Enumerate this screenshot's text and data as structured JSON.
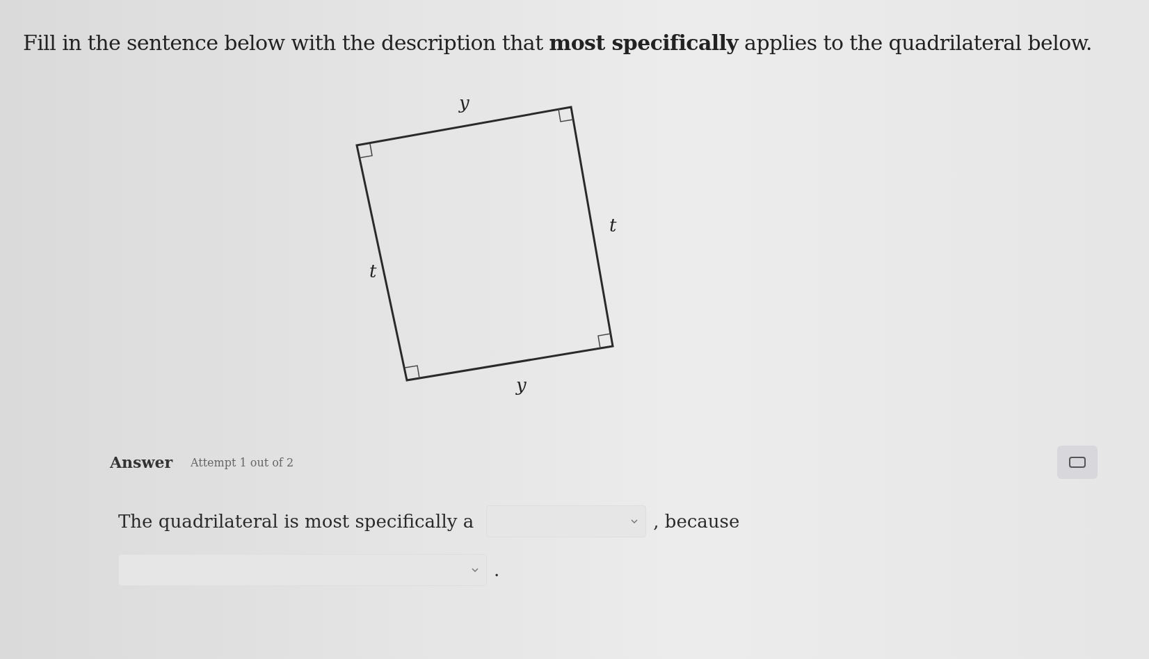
{
  "question": "Fill in the sentence below with the description that **most specifically** applies to the quadrilateral below.",
  "figure": {
    "side_labels": [
      "y",
      "t",
      "t",
      "y"
    ]
  },
  "answer": {
    "heading": "Answer",
    "attempt": "Attempt 1 out of 2"
  },
  "sentence": {
    "start": "The quadrilateral is most specifically a",
    "middle": ", because",
    "end": "."
  }
}
